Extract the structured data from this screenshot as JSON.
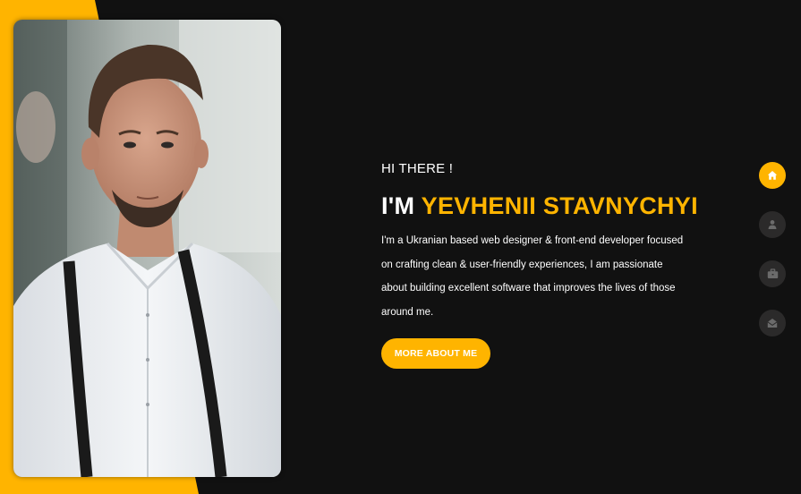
{
  "colors": {
    "accent": "#ffb400",
    "background": "#111111",
    "nav_inactive": "#2b2a2a",
    "text": "#ffffff"
  },
  "hero": {
    "greeting": "HI THERE !",
    "headline_prefix": "I'M",
    "name": "YEVHENII STAVNYCHYI",
    "bio": "I'm a Ukranian based web designer & front‑end developer focused on crafting clean & user‑friendly experiences, I am passionate about building excellent software that improves the lives of those around me.",
    "cta_label": "MORE ABOUT ME"
  },
  "side_nav": {
    "items": [
      {
        "icon": "home-icon",
        "active": true
      },
      {
        "icon": "user-icon",
        "active": false
      },
      {
        "icon": "briefcase-icon",
        "active": false
      },
      {
        "icon": "envelope-open-icon",
        "active": false
      }
    ]
  }
}
